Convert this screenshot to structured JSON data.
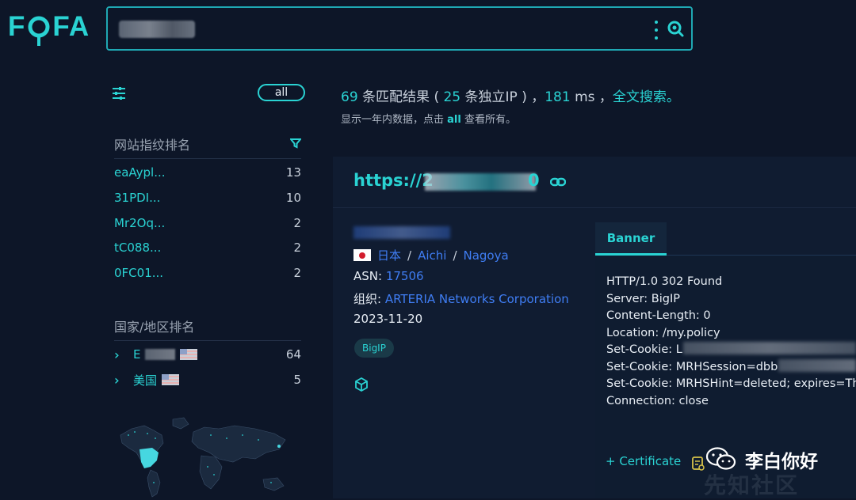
{
  "logo": "FOFA",
  "search": {
    "value": "",
    "placeholder": ""
  },
  "sidebar": {
    "all_label": "all",
    "fingerprint": {
      "title": "网站指纹排名",
      "items": [
        {
          "label": "eaAypl...",
          "count": "13"
        },
        {
          "label": "31PDI...",
          "count": "10"
        },
        {
          "label": "Mr2Oq...",
          "count": "2"
        },
        {
          "label": "tC088...",
          "count": "2"
        },
        {
          "label": "0FC01...",
          "count": "2"
        }
      ]
    },
    "country": {
      "title": "国家/地区排名",
      "items": [
        {
          "label": "E",
          "count": "64"
        },
        {
          "label": "美国",
          "count": "5"
        }
      ]
    }
  },
  "results": {
    "count": "69",
    "count_text": " 条匹配结果 ( ",
    "ip_count": "25",
    "ip_text": " 条独立IP ) ，",
    "time": "181",
    "time_text": " ms ，",
    "fulltext": "全文搜索。",
    "sub_prefix": "显示一年内数据，点击 ",
    "sub_all": "all",
    "sub_suffix": " 查看所有。"
  },
  "card": {
    "host": "https://2",
    "host_tail": "0",
    "geo": {
      "country": "日本",
      "region": "Aichi",
      "city": "Nagoya"
    },
    "asn_label": "ASN: ",
    "asn": "17506",
    "org_label": "组织: ",
    "org": "ARTERIA Networks Corporation",
    "date": "2023-11-20",
    "tag": "BigIP",
    "banner_tab": "Banner",
    "banner": [
      "HTTP/1.0 302 Found",
      "Server: BigIP",
      "Content-Length: 0",
      "Location: /my.policy",
      "Set-Cookie: L",
      "Set-Cookie: MRHSession=dbb",
      "Set-Cookie: MRHSHint=deleted; expires=Thu",
      "Connection: close"
    ],
    "certificate": "+ Certificate"
  },
  "watermark": {
    "author": "李白你好",
    "site": "先知社区"
  },
  "colors": {
    "accent": "#2ad3d3",
    "link": "#3f7df3",
    "bg": "#0d1628"
  }
}
